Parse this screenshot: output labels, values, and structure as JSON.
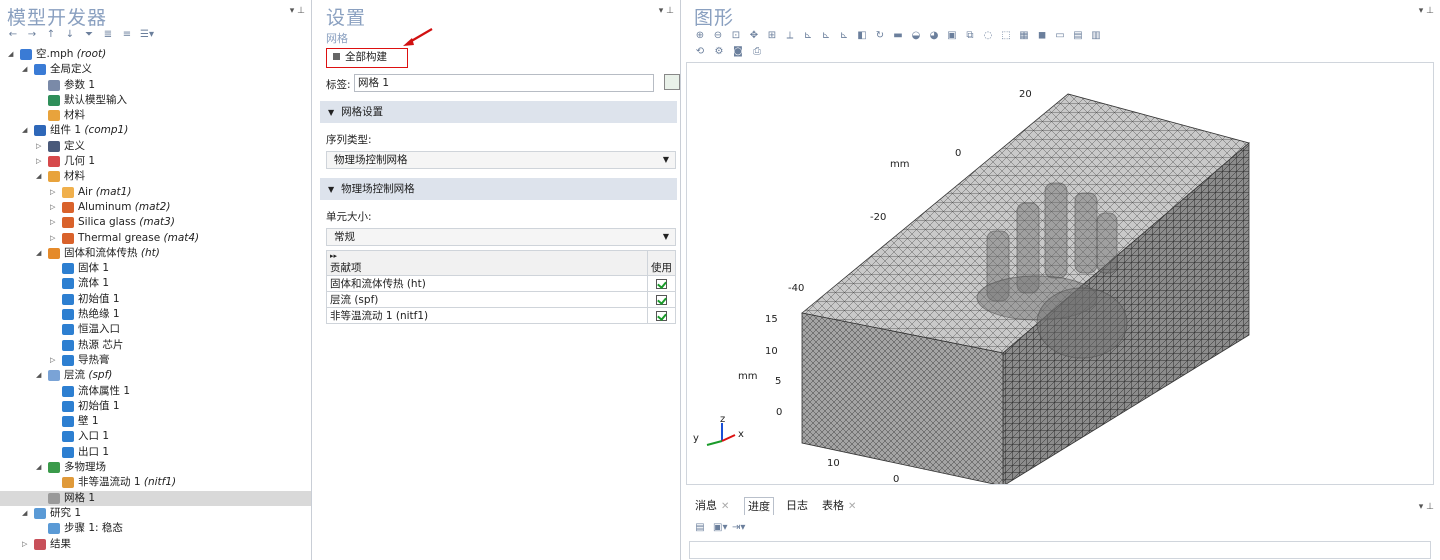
{
  "left_pane": {
    "title": "模型开发器",
    "tree": [
      {
        "label": "空.mph",
        "tag": "(root)",
        "depth": 0,
        "icon": "model-icon",
        "color": "#3a7bd5",
        "twisty": "open"
      },
      {
        "label": "全局定义",
        "tag": "",
        "depth": 1,
        "icon": "globe-icon",
        "color": "#3a7bd5",
        "twisty": "open"
      },
      {
        "label": "参数 1",
        "tag": "",
        "depth": 2,
        "icon": "parameter-icon",
        "color": "#7a8aa8",
        "twisty": ""
      },
      {
        "label": "默认模型输入",
        "tag": "",
        "depth": 2,
        "icon": "model-input-icon",
        "color": "#2f8f5a",
        "twisty": ""
      },
      {
        "label": "材料",
        "tag": "",
        "depth": 2,
        "icon": "material-icon",
        "color": "#e8a33c",
        "twisty": ""
      },
      {
        "label": "组件 1",
        "tag": "(comp1)",
        "depth": 1,
        "icon": "component-icon",
        "color": "#2e67b8",
        "twisty": "open"
      },
      {
        "label": "定义",
        "tag": "",
        "depth": 2,
        "icon": "definitions-icon",
        "color": "#4a5a7a",
        "twisty": "closed"
      },
      {
        "label": "几何 1",
        "tag": "",
        "depth": 2,
        "icon": "geometry-icon",
        "color": "#d6494b",
        "twisty": "closed"
      },
      {
        "label": "材料",
        "tag": "",
        "depth": 2,
        "icon": "materials-icon",
        "color": "#e8a33c",
        "twisty": "open"
      },
      {
        "label": "Air",
        "tag": "(mat1)",
        "depth": 3,
        "icon": "material-icon",
        "color": "#f0b04c",
        "twisty": "closed"
      },
      {
        "label": "Aluminum",
        "tag": "(mat2)",
        "depth": 3,
        "icon": "material-icon",
        "color": "#d9622b",
        "twisty": "closed"
      },
      {
        "label": "Silica glass",
        "tag": "(mat3)",
        "depth": 3,
        "icon": "material-icon",
        "color": "#d9622b",
        "twisty": "closed"
      },
      {
        "label": "Thermal grease",
        "tag": "(mat4)",
        "depth": 3,
        "icon": "material-icon",
        "color": "#d9622b",
        "twisty": "closed"
      },
      {
        "label": "固体和流体传热",
        "tag": "(ht)",
        "depth": 2,
        "icon": "heat-transfer-icon",
        "color": "#e58a2a",
        "twisty": "open"
      },
      {
        "label": "固体 1",
        "tag": "",
        "depth": 3,
        "icon": "domain-feature-icon",
        "color": "#2d7fd1",
        "twisty": ""
      },
      {
        "label": "流体 1",
        "tag": "",
        "depth": 3,
        "icon": "domain-feature-icon",
        "color": "#2d7fd1",
        "twisty": ""
      },
      {
        "label": "初始值 1",
        "tag": "",
        "depth": 3,
        "icon": "domain-feature-icon",
        "color": "#2d7fd1",
        "twisty": ""
      },
      {
        "label": "热绝缘 1",
        "tag": "",
        "depth": 3,
        "icon": "boundary-feature-icon",
        "color": "#2d7fd1",
        "twisty": ""
      },
      {
        "label": "恒温入口",
        "tag": "",
        "depth": 3,
        "icon": "boundary-feature-icon",
        "color": "#2d7fd1",
        "twisty": ""
      },
      {
        "label": "热源 芯片",
        "tag": "",
        "depth": 3,
        "icon": "boundary-feature-icon",
        "color": "#2d7fd1",
        "twisty": ""
      },
      {
        "label": "导热膏",
        "tag": "",
        "depth": 3,
        "icon": "boundary-feature-icon",
        "color": "#2d7fd1",
        "twisty": "closed"
      },
      {
        "label": "层流",
        "tag": "(spf)",
        "depth": 2,
        "icon": "laminar-flow-icon",
        "color": "#7aa3d6",
        "twisty": "open"
      },
      {
        "label": "流体属性 1",
        "tag": "",
        "depth": 3,
        "icon": "domain-feature-icon",
        "color": "#2d7fd1",
        "twisty": ""
      },
      {
        "label": "初始值 1",
        "tag": "",
        "depth": 3,
        "icon": "domain-feature-icon",
        "color": "#2d7fd1",
        "twisty": ""
      },
      {
        "label": "壁 1",
        "tag": "",
        "depth": 3,
        "icon": "boundary-feature-icon",
        "color": "#2d7fd1",
        "twisty": ""
      },
      {
        "label": "入口 1",
        "tag": "",
        "depth": 3,
        "icon": "boundary-feature-icon",
        "color": "#2d7fd1",
        "twisty": ""
      },
      {
        "label": "出口 1",
        "tag": "",
        "depth": 3,
        "icon": "boundary-feature-icon",
        "color": "#2d7fd1",
        "twisty": ""
      },
      {
        "label": "多物理场",
        "tag": "",
        "depth": 2,
        "icon": "multiphysics-icon",
        "color": "#3a9a4a",
        "twisty": "open"
      },
      {
        "label": "非等温流动 1",
        "tag": "(nitf1)",
        "depth": 3,
        "icon": "nonisothermal-flow-icon",
        "color": "#e09a3a",
        "twisty": ""
      },
      {
        "label": "网格 1",
        "tag": "",
        "depth": 2,
        "icon": "mesh-icon",
        "color": "#9a9a9a",
        "twisty": "",
        "selected": true
      },
      {
        "label": "研究 1",
        "tag": "",
        "depth": 1,
        "icon": "study-icon",
        "color": "#5a9ad6",
        "twisty": "open"
      },
      {
        "label": "步骤 1: 稳态",
        "tag": "",
        "depth": 2,
        "icon": "stationary-step-icon",
        "color": "#5a9ad6",
        "twisty": ""
      },
      {
        "label": "结果",
        "tag": "",
        "depth": 1,
        "icon": "results-icon",
        "color": "#c8505a",
        "twisty": "closed"
      }
    ]
  },
  "mid_pane": {
    "title": "设置",
    "subtitle": "网格",
    "build_all": "全部构建",
    "label_caption": "标签:",
    "label_value": "网格 1",
    "section_mesh_settings": "网格设置",
    "sequence_type_label": "序列类型:",
    "sequence_type_value": "物理场控制网格",
    "section_physics_controlled": "物理场控制网格",
    "element_size_label": "单元大小:",
    "element_size_value": "常规",
    "contrib_header": "贡献项",
    "use_header": "使用",
    "contributors": [
      {
        "name": "固体和流体传热 (ht)",
        "used": true
      },
      {
        "name": "层流 (spf)",
        "used": true
      },
      {
        "name": "非等温流动 1 (nitf1)",
        "used": true
      }
    ]
  },
  "right_pane": {
    "title": "图形",
    "axis_unit": "mm",
    "top_ticks": [
      "20",
      "0",
      "-20",
      "-40"
    ],
    "z_ticks": [
      "15",
      "10",
      "5",
      "0"
    ],
    "x_ticks": [
      "10",
      "0"
    ],
    "triad": {
      "y": "y",
      "z": "z",
      "x": "x"
    }
  },
  "bottom_tabs": {
    "tabs": [
      "消息",
      "进度",
      "日志",
      "表格"
    ],
    "active": "进度"
  },
  "colors": {
    "title": "#8aa0c0",
    "accent_red": "#d11111",
    "selection": "#d9d9d9",
    "section_bg": "#dde3ec"
  }
}
